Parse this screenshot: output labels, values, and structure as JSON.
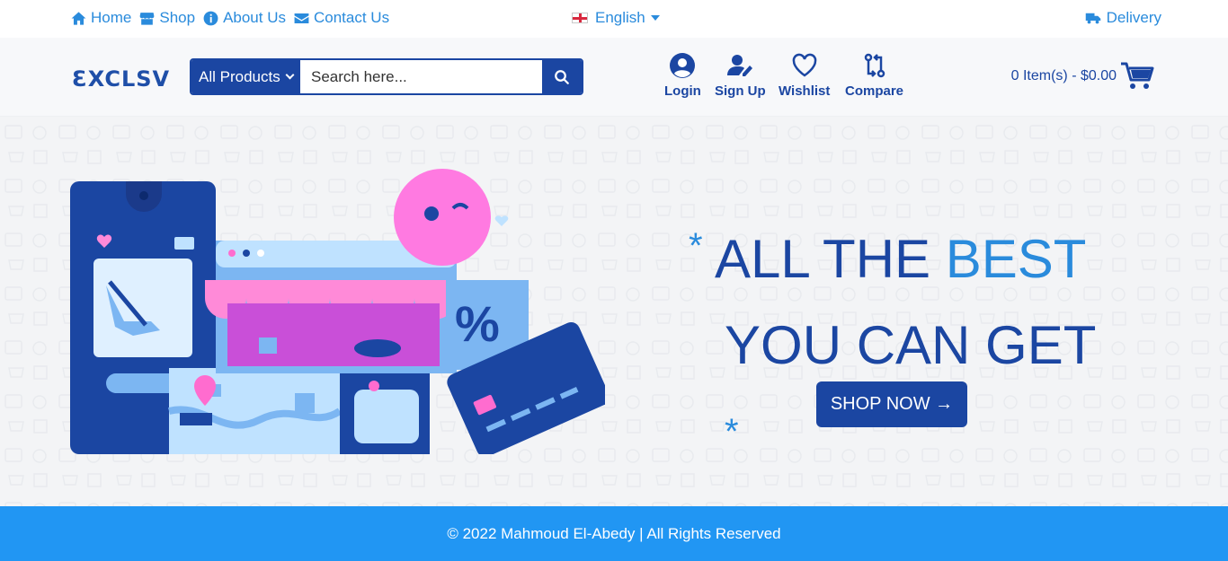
{
  "topbar": {
    "links": [
      {
        "label": "Home",
        "icon": "home-icon"
      },
      {
        "label": "Shop",
        "icon": "store-icon"
      },
      {
        "label": "About Us",
        "icon": "info-circle-icon"
      },
      {
        "label": "Contact Us",
        "icon": "envelope-icon"
      }
    ],
    "language": "English",
    "delivery": "Delivery"
  },
  "header": {
    "logo": "ƐXCLSV",
    "search": {
      "category": "All Products",
      "placeholder": "Search here..."
    },
    "account": {
      "login": "Login",
      "signup": "Sign Up",
      "wishlist": "Wishlist",
      "compare": "Compare"
    },
    "cart": "0 Item(s) - $0.00"
  },
  "hero": {
    "star": "*",
    "line1_a": "ALL THE ",
    "line1_b": "BEST",
    "line2": "YOU CAN GET",
    "cta": "SHOP NOW →"
  },
  "footer": {
    "text": "© 2022 Mahmoud El-Abedy | All Rights Reserved"
  },
  "colors": {
    "primary": "#1b46a2",
    "accent": "#2a8bdc",
    "footer_bg": "#2196f3"
  }
}
